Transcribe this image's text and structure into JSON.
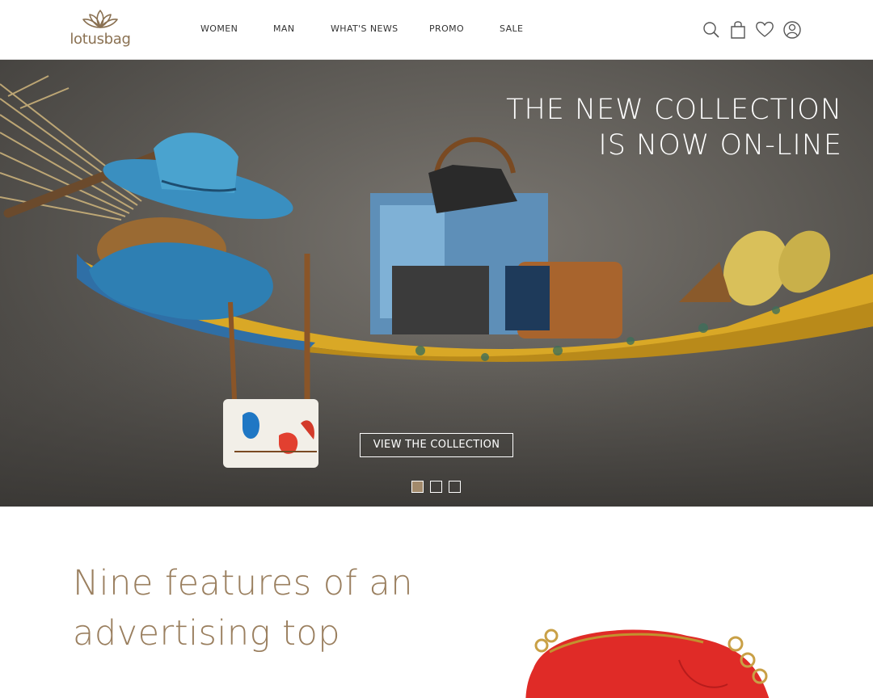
{
  "brand": {
    "name": "lotusbag",
    "color": "#8a7152"
  },
  "nav": {
    "items": [
      {
        "label": "WOMEN"
      },
      {
        "label": "MAN"
      },
      {
        "label": "WHAT'S NEWS"
      },
      {
        "label": "PROMO"
      },
      {
        "label": "SALE"
      }
    ]
  },
  "header_icons": [
    "search-icon",
    "shopping-bag-icon",
    "heart-icon",
    "user-icon"
  ],
  "hero": {
    "headline_line1": "THE NEW COLLECTION",
    "headline_line2": "IS NOW ON-LINE",
    "cta_label": "VIEW THE COLLECTION",
    "slides_total": 3,
    "active_slide": 1,
    "active_dot_color": "#a28a6c"
  },
  "features": {
    "title_line1": "Nine features of an",
    "title_line2": "advertising top",
    "title_color": "#9a7f5f"
  }
}
